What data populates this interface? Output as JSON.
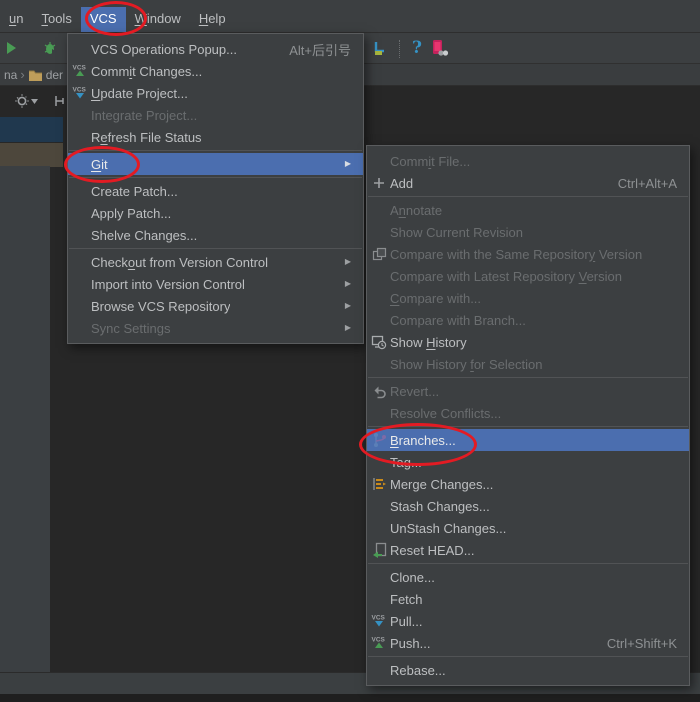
{
  "annotation": {
    "color": "#E31B23",
    "shapes": [
      "ellipse-around-vcs",
      "ellipse-around-git",
      "ellipse-around-branches"
    ]
  },
  "colors": {
    "selection_blue": "#4B6EAF",
    "popup_background": "#3C3F41",
    "disabled_text": "#6A6D6F",
    "vcs_commit_green": "#499C54",
    "vcs_update_blue": "#3592C4"
  },
  "menu_bar": {
    "items": [
      {
        "label": "un",
        "mnemonic": 0
      },
      {
        "label": "Tools",
        "mnemonic": 0
      },
      {
        "label": "VCS",
        "selected": true
      },
      {
        "label": "Window",
        "mnemonic": 0
      },
      {
        "label": "Help",
        "mnemonic": 0
      }
    ]
  },
  "toolbar": {
    "icons": [
      "run-icon",
      "debug-icon",
      "profiler-icon",
      "sdk-manager-icon",
      "help-icon",
      "device-manager-icon"
    ]
  },
  "breadcrumb": {
    "crumb1": "na",
    "separator": "›",
    "crumb2": "der",
    "folder_icon": "folder-icon"
  },
  "tool_window_bar": {
    "icons": [
      "settings-gear-icon",
      "pin-icon"
    ]
  },
  "vcs_menu": {
    "items": [
      {
        "label": "VCS Operations Popup...",
        "shortcut": "Alt+后引号"
      },
      {
        "label": "Commit Changes...",
        "icon": "vcs-commit-icon",
        "mnemonic": 4
      },
      {
        "label": "Update Project...",
        "icon": "vcs-update-icon",
        "mnemonic": 0
      },
      {
        "label": "Integrate Project...",
        "disabled": true
      },
      {
        "label": "Refresh File Status",
        "mnemonic": 1
      },
      {
        "type": "separator"
      },
      {
        "label": "Git",
        "selected": true,
        "submenu": true,
        "mnemonic": 0
      },
      {
        "type": "separator"
      },
      {
        "label": "Create Patch..."
      },
      {
        "label": "Apply Patch..."
      },
      {
        "label": "Shelve Changes..."
      },
      {
        "type": "separator"
      },
      {
        "label": "Checkout from Version Control",
        "submenu": true,
        "mnemonic": 5
      },
      {
        "label": "Import into Version Control",
        "submenu": true
      },
      {
        "label": "Browse VCS Repository",
        "submenu": true
      },
      {
        "label": "Sync Settings",
        "disabled": true,
        "submenu": true
      }
    ]
  },
  "git_menu": {
    "items": [
      {
        "label": "Commit File...",
        "disabled": true,
        "mnemonic": 4
      },
      {
        "label": "Add",
        "icon": "plus-icon",
        "shortcut": "Ctrl+Alt+A"
      },
      {
        "type": "separator"
      },
      {
        "label": "Annotate",
        "disabled": true,
        "mnemonic": 1
      },
      {
        "label": "Show Current Revision",
        "disabled": true
      },
      {
        "label": "Compare with the Same Repository Version",
        "disabled": true,
        "icon": "compare-icon",
        "mnemonic": 31
      },
      {
        "label": "Compare with Latest Repository Version",
        "disabled": true,
        "mnemonic": 31
      },
      {
        "label": "Compare with...",
        "disabled": true,
        "mnemonic": 0
      },
      {
        "label": "Compare with Branch...",
        "disabled": true
      },
      {
        "label": "Show History",
        "icon": "history-icon",
        "mnemonic": 5
      },
      {
        "label": "Show History for Selection",
        "disabled": true,
        "mnemonic": 13
      },
      {
        "type": "separator"
      },
      {
        "label": "Revert...",
        "disabled": true,
        "icon": "revert-icon"
      },
      {
        "label": "Resolve Conflicts...",
        "disabled": true
      },
      {
        "type": "separator"
      },
      {
        "label": "Branches...",
        "selected": true,
        "icon": "branch-icon",
        "mnemonic": 0
      },
      {
        "label": "Tag..."
      },
      {
        "label": "Merge Changes...",
        "icon": "merge-icon"
      },
      {
        "label": "Stash Changes..."
      },
      {
        "label": "UnStash Changes..."
      },
      {
        "label": "Reset HEAD...",
        "icon": "reset-head-icon"
      },
      {
        "type": "separator"
      },
      {
        "label": "Clone..."
      },
      {
        "label": "Fetch"
      },
      {
        "label": "Pull...",
        "icon": "vcs-update-icon"
      },
      {
        "label": "Push...",
        "icon": "vcs-commit-icon",
        "shortcut": "Ctrl+Shift+K"
      },
      {
        "type": "separator"
      },
      {
        "label": "Rebase..."
      }
    ]
  }
}
